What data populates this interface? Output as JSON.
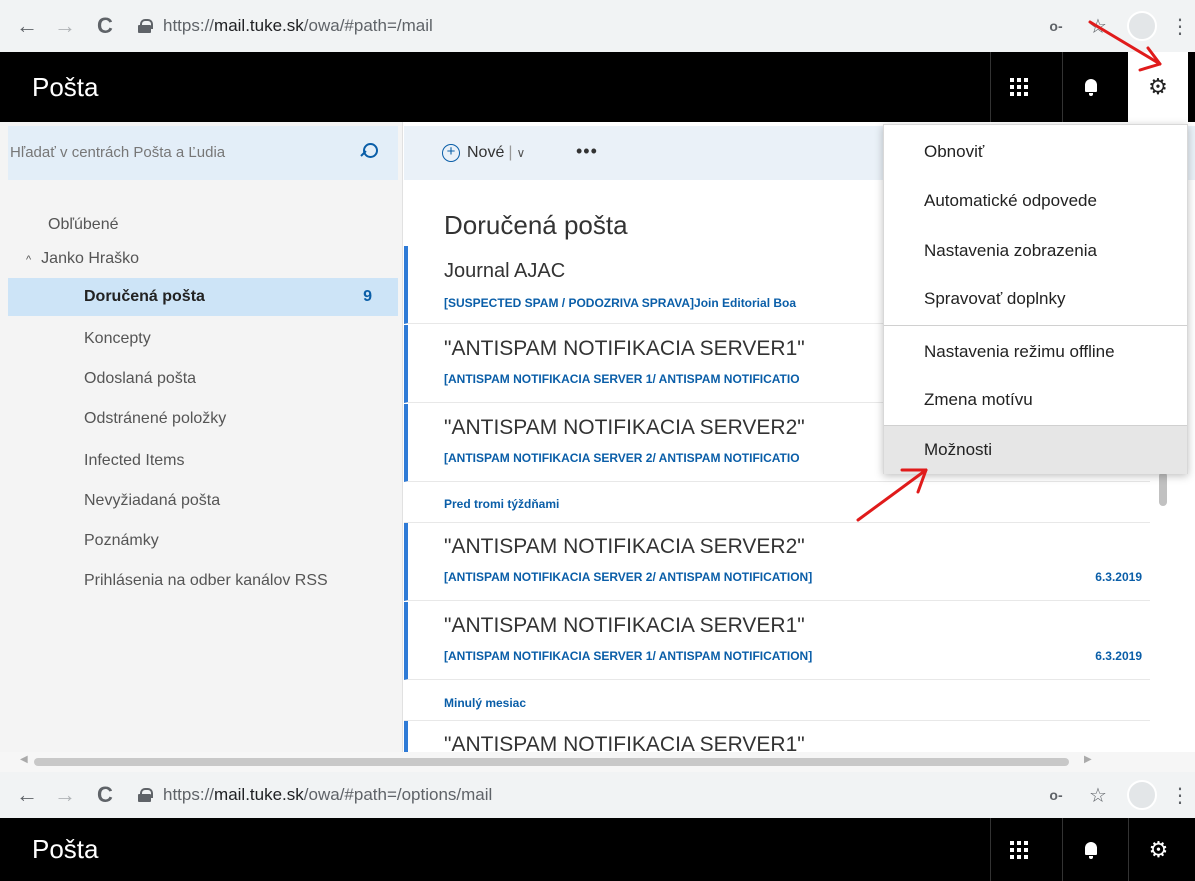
{
  "browser_top": {
    "back_icon": "←",
    "forward_icon": "→",
    "reload_icon": "C",
    "url_scheme": "https://",
    "url_host": "mail.tuke.sk",
    "url_path": "/owa/#path=/mail",
    "key_icon": "o-",
    "star_icon": "☆",
    "menu_icon": "⋮"
  },
  "app_header": {
    "title": "Pošta",
    "settings_icon": "⚙"
  },
  "search": {
    "placeholder": "Hľadať v centrách Pošta a Ľudia"
  },
  "nav": {
    "favorites": "Obľúbené",
    "account_caret": "^",
    "account": "Janko Hraško",
    "folders": [
      {
        "label": "Doručená pošta",
        "count": "9"
      },
      {
        "label": "Koncepty"
      },
      {
        "label": "Odoslaná pošta"
      },
      {
        "label": "Odstránené položky"
      },
      {
        "label": "Infected Items"
      },
      {
        "label": "Nevyžiadaná pošta"
      },
      {
        "label": "Poznámky"
      },
      {
        "label": "Prihlásenia na odber kanálov RSS"
      }
    ]
  },
  "toolbar": {
    "new_plus": "+",
    "new_label": "Nové",
    "new_divider": "|",
    "new_chevron": "∨",
    "more": "•••"
  },
  "mail": {
    "folder_title": "Doručená pošta",
    "messages_top": [
      {
        "sender": "Journal AJAC",
        "subject": "[SUSPECTED SPAM / PODOZRIVA SPRAVA]Join Editorial Boa"
      },
      {
        "sender": "\"ANTISPAM NOTIFIKACIA SERVER1\"",
        "subject": "[ANTISPAM NOTIFIKACIA SERVER 1/ ANTISPAM NOTIFICATIO"
      },
      {
        "sender": "\"ANTISPAM NOTIFIKACIA SERVER2\"",
        "subject": "[ANTISPAM NOTIFIKACIA SERVER 2/ ANTISPAM NOTIFICATIO"
      }
    ],
    "group_three_weeks": "Pred tromi týždňami",
    "messages_mid": [
      {
        "sender": "\"ANTISPAM NOTIFIKACIA SERVER2\"",
        "subject": "[ANTISPAM NOTIFIKACIA SERVER 2/ ANTISPAM NOTIFICATION]",
        "date": "6.3.2019"
      },
      {
        "sender": "\"ANTISPAM NOTIFIKACIA SERVER1\"",
        "subject": "[ANTISPAM NOTIFIKACIA SERVER 1/ ANTISPAM NOTIFICATION]",
        "date": "6.3.2019"
      }
    ],
    "group_last_month": "Minulý mesiac",
    "messages_bottom": [
      {
        "sender": "\"ANTISPAM NOTIFIKACIA SERVER1\""
      }
    ]
  },
  "settings_menu": {
    "items": [
      "Obnoviť",
      "Automatické odpovede",
      "Nastavenia zobrazenia",
      "Spravovať doplnky",
      "Nastavenia režimu offline",
      "Zmena motívu",
      "Možnosti"
    ]
  },
  "browser_bottom": {
    "url_scheme": "https://",
    "url_host": "mail.tuke.sk",
    "url_path": "/owa/#path=/options/mail"
  },
  "colors": {
    "annotation": "#e01b1b",
    "accent": "#0a5ea8",
    "selected": "#cde4f7"
  }
}
